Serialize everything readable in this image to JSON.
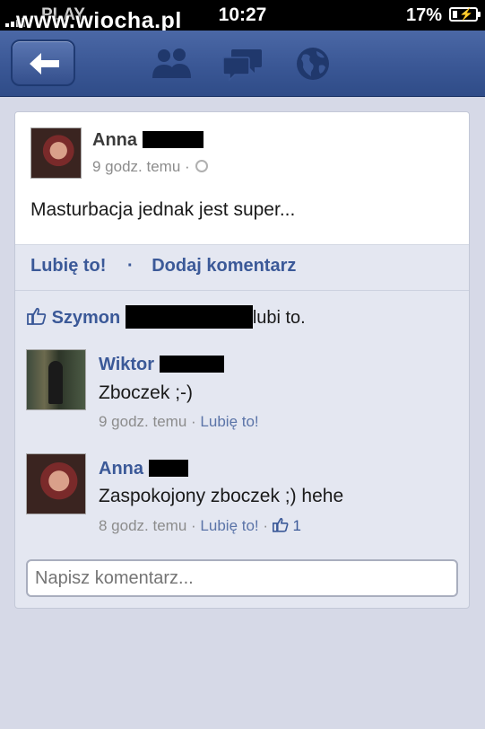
{
  "status_bar": {
    "carrier": "PLAY",
    "watermark": "www.wiocha.pl",
    "time": "10:27",
    "battery": "17%"
  },
  "nav": {
    "back_icon": "back-arrow-icon",
    "icons": [
      "friends-icon",
      "messages-icon",
      "globe-notifications-icon"
    ]
  },
  "post": {
    "author": "Anna",
    "time": "9 godz. temu",
    "separator": "·",
    "text": "Masturbacja jednak jest super...",
    "actions": {
      "like": "Lubię to!",
      "dot": "·",
      "comment": "Dodaj komentarz"
    },
    "likes": {
      "name": "Szymon",
      "suffix": "lubi to."
    }
  },
  "comments": [
    {
      "author": "Wiktor",
      "text": "Zboczek ;-)",
      "time": "9 godz. temu",
      "sep": "·",
      "like": "Lubię to!"
    },
    {
      "author": "Anna",
      "text": "Zaspokojony zboczek ;) hehe",
      "time": "8 godz. temu",
      "sep": "·",
      "like": "Lubię to!",
      "sep2": "·",
      "like_count": "1"
    }
  ],
  "comment_input": {
    "placeholder": "Napisz komentarz..."
  },
  "colors": {
    "navbar": "#3b5998",
    "link": "#3b5998",
    "background": "#d6d9e7"
  }
}
